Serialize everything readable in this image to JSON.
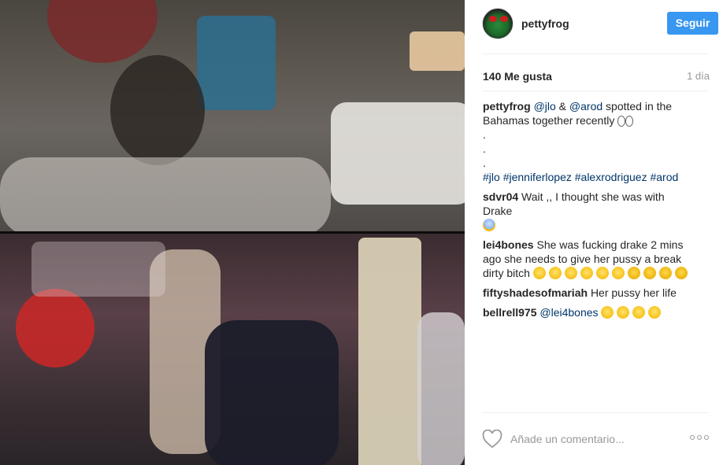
{
  "post": {
    "username": "pettyfrog",
    "follow_label": "Seguir",
    "likes": "140 Me gusta",
    "time_ago": "1 día"
  },
  "caption": {
    "user": "pettyfrog",
    "mention1": "@jlo",
    "amp": " & ",
    "mention2": "@arod",
    "text": " spotted in the Bahamas together recently",
    "dot": ".",
    "tags": [
      "#jlo",
      "#jenniferlopez",
      "#alexrodriguez",
      "#arod"
    ]
  },
  "comments": [
    {
      "user": "sdvr04",
      "text": "Wait ,, I thought she was with Drake"
    },
    {
      "user": "lei4bones",
      "text": "She was fucking drake 2 mins ago she needs to give her pussy a break dirty bitch"
    },
    {
      "user": "fiftyshadesofmariah",
      "text": "Her pussy her life"
    },
    {
      "user": "bellrell975",
      "mention": "@lei4bones"
    }
  ],
  "composer": {
    "placeholder": "Añade un comentario..."
  },
  "icons": {
    "like": "heart-icon",
    "more": "more-options-icon",
    "avatar": "frog-avatar"
  },
  "colors": {
    "accent": "#3897f0",
    "link": "#003569",
    "muted": "#999999"
  }
}
